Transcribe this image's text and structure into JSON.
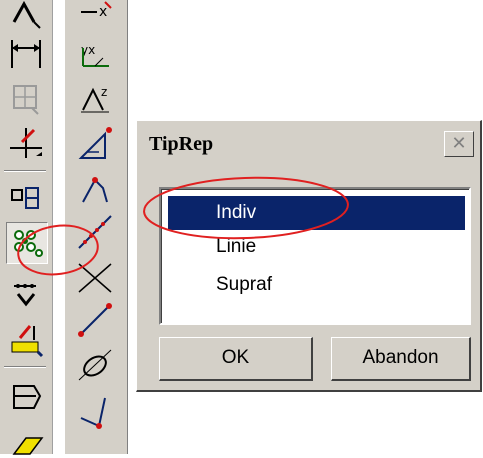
{
  "dialog": {
    "title": "TipRep",
    "close_icon": "close-icon",
    "list": {
      "items": [
        {
          "label": "Indiv",
          "selected": true
        },
        {
          "label": "Linie",
          "selected": false
        },
        {
          "label": "Supraf",
          "selected": false
        }
      ]
    },
    "ok_label": "OK",
    "cancel_label": "Abandon",
    "close_symbol": "✕"
  },
  "toolbar_left": {
    "tools": [
      "arrow-tool-icon",
      "dimension-horizontal-icon",
      "grid-icon",
      "angle-marker-icon",
      "split-icon",
      "point-pattern-icon",
      "measure-icon",
      "yellow-marker-icon",
      "layers-icon",
      "yellow-block-icon"
    ]
  },
  "toolbar_right": {
    "tools": [
      "x-axis-icon",
      "yx-axis-icon",
      "z-axis-icon",
      "triangle-icon",
      "node-angle-icon",
      "chain-line-icon",
      "cross-icon",
      "line-segment-icon",
      "ellipse-icon",
      "vertex-icon"
    ]
  },
  "colors": {
    "selection": "#0a246a",
    "annotation": "#e02020",
    "face": "#d4d0c8"
  }
}
